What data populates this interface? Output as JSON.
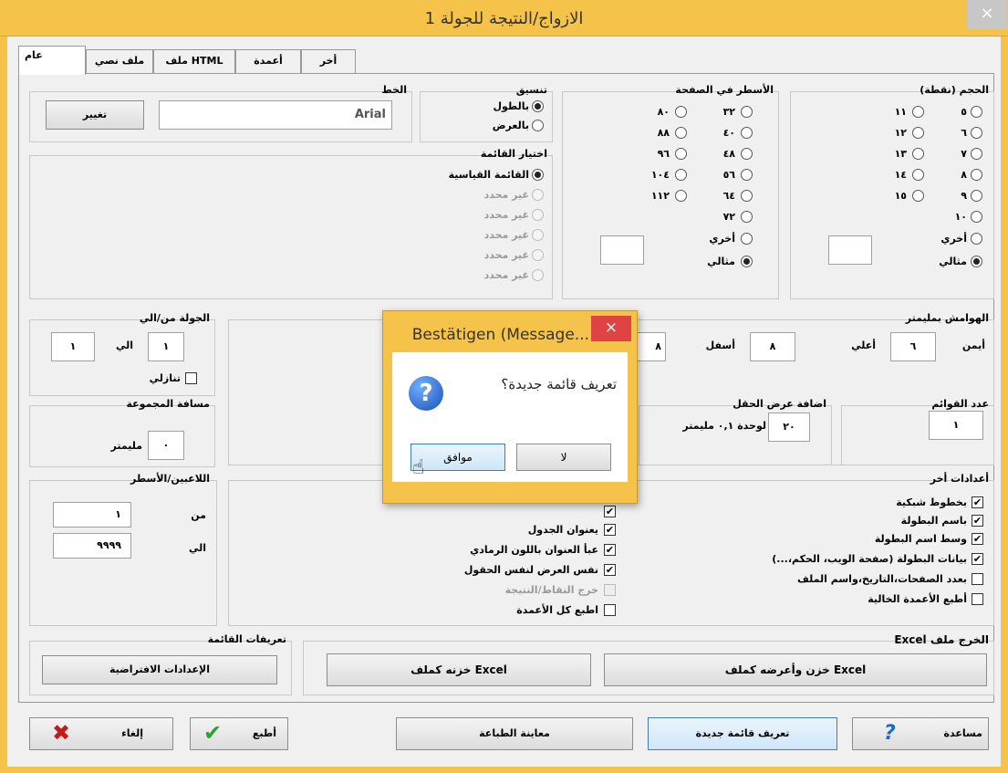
{
  "window": {
    "title": "الازواج/النتيجة للجولة 1",
    "close": "×"
  },
  "tabs": [
    "عام",
    "ملف نصي",
    "ملف HTML",
    "أعمدة",
    "أخر"
  ],
  "font": {
    "label": "الخط",
    "value": "Arial",
    "change_button": "تغيير"
  },
  "format": {
    "label": "تنسيق",
    "options": [
      "بالطول",
      "بالعرض"
    ]
  },
  "list_choice": {
    "label": "اختيار القائمة",
    "standard": "القائمة القياسية",
    "undefined_items": [
      "غير محدد",
      "غير محدد",
      "غير محدد",
      "غير محدد",
      "غير محدد"
    ]
  },
  "lines_per_page": {
    "label": "الأسطر في الصفحة",
    "col_right": [
      "٣٢",
      "٤٠",
      "٤٨",
      "٥٦",
      "٦٤",
      "٧٢"
    ],
    "col_left": [
      "٨٠",
      "٨٨",
      "٩٦",
      "١٠٤",
      "١١٢"
    ],
    "other": "أخري",
    "ideal": "مثالي"
  },
  "size_points": {
    "label": "الحجم (نقطة)",
    "col_right": [
      "٥",
      "٦",
      "٧",
      "٨",
      "٩",
      "١٠"
    ],
    "col_left": [
      "١١",
      "١٢",
      "١٣",
      "١٤",
      "١٥"
    ],
    "other": "أخري",
    "ideal": "مثالي"
  },
  "round_range": {
    "label": "الجولة من/الي",
    "from_value": "١",
    "to_label": "الي",
    "to_value": "١",
    "descending": "تنازلي"
  },
  "group_distance": {
    "label": "مسافة المجموعة",
    "value": "٠",
    "unit": "مليمتر"
  },
  "margins": {
    "label": "الهوامش بمليمتر",
    "right_label": "أيمن",
    "right_value": "٦",
    "top_label": "أعلي",
    "top_value": "٨",
    "bottom_label": "أسفل",
    "bottom_value": "٨",
    "left_value": "٨"
  },
  "columns_count": {
    "label": "عدد القوائم",
    "value": "١"
  },
  "field_width": {
    "label": "اضافة عرض الحقل",
    "value": "٢٠",
    "unit": "لوحدة ٠,١ مليمتر"
  },
  "players_lines": {
    "label": "اللاعبين/الأسطر",
    "from_label": "من",
    "from_value": "١",
    "to_label": "الي",
    "to_value": "٩٩٩٩"
  },
  "other_settings": {
    "label": "أعدادات أخر",
    "items": [
      {
        "label": "بخطوط شبكية",
        "checked": true
      },
      {
        "label": "باسم البطولة",
        "checked": true
      },
      {
        "label": "وسط اسم البطولة",
        "checked": true
      },
      {
        "label": "بيانات البطولة (صفحة الويب، الحكم،...)",
        "checked": true
      },
      {
        "label": "بعدد الصفحات،التاريخ،واسم الملف",
        "checked": false
      },
      {
        "label": "أطبع الأعمدة الخالية",
        "checked": false
      }
    ]
  },
  "table_settings": {
    "items": [
      {
        "label": "يعنوان الجدول",
        "checked": true,
        "disabled": false
      },
      {
        "label": "عبأ العنوان باللون الرمادي",
        "checked": true,
        "disabled": false
      },
      {
        "label": "نفس العرض لنفس الحقول",
        "checked": true,
        "disabled": false
      },
      {
        "label": "خرج النقاط/النتيجة",
        "checked": false,
        "disabled": true
      },
      {
        "label": "اطبع كل الأعمدة",
        "checked": false,
        "disabled": false
      }
    ]
  },
  "list_defs": {
    "label": "تعريفات القائمة",
    "button": "الإعدادات الافتراضية"
  },
  "excel": {
    "label": "الخرج ملف Excel",
    "save_show": "خزن وأعرضه كملف Excel",
    "save": "خزنه كملف Excel"
  },
  "bottom": {
    "help": "مساعدة",
    "define_new": "تعريف قائمة جديدة",
    "preview": "معاينة الطباعة",
    "print": "أطبع",
    "cancel": "إلغاء"
  },
  "dialog": {
    "title": "Bestätigen (Message...",
    "close": "×",
    "message": "تعريف قائمة جديدة؟",
    "icon": "?",
    "no": "لا",
    "ok": "موافق"
  },
  "colors": {
    "accent": "#f6c34a",
    "close_red": "#e04343",
    "help_blue": "#1b6ac9",
    "check_green": "#2ea02e",
    "cancel_red": "#c41a1a"
  }
}
